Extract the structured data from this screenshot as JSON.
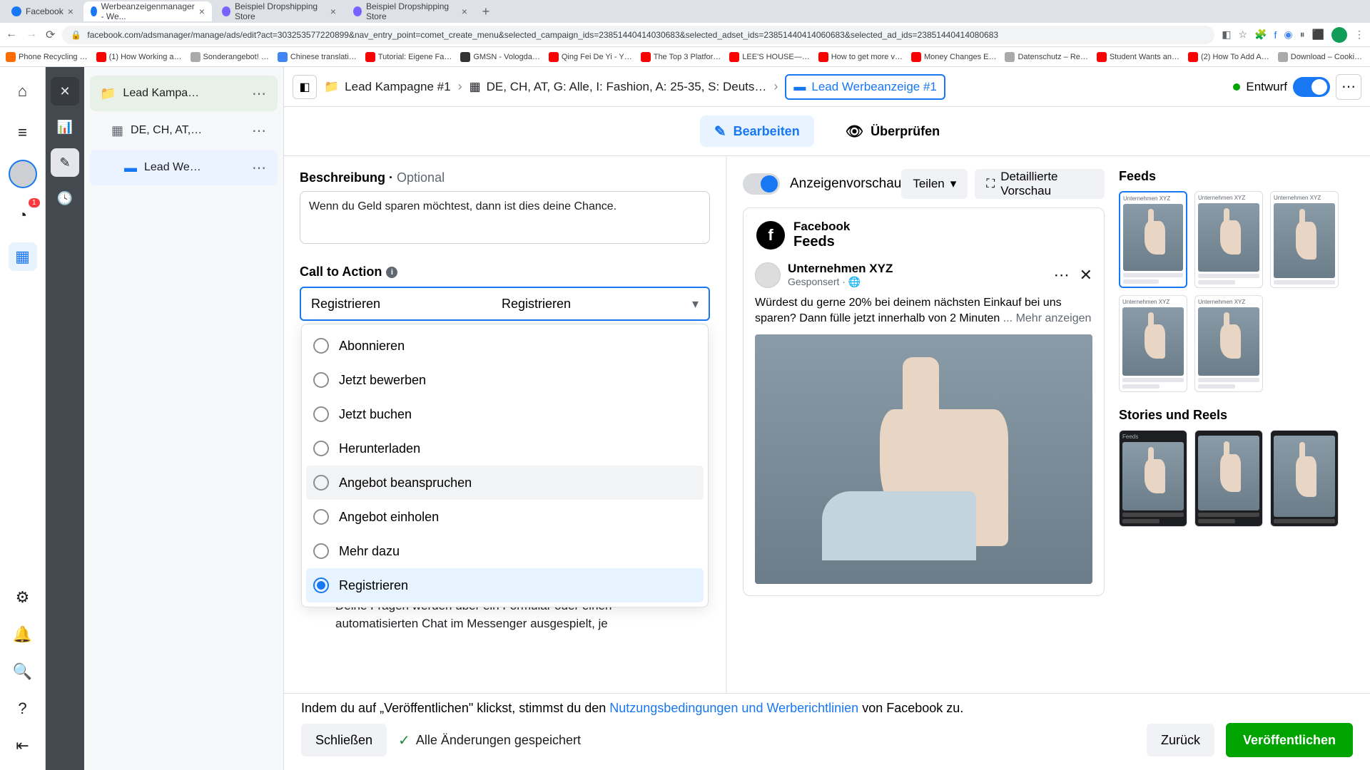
{
  "browser": {
    "tabs": [
      {
        "title": "Facebook"
      },
      {
        "title": "Werbeanzeigenmanager - We..."
      },
      {
        "title": "Beispiel Dropshipping Store"
      },
      {
        "title": "Beispiel Dropshipping Store"
      }
    ],
    "url": "facebook.com/adsmanager/manage/ads/edit?act=303253577220899&nav_entry_point=comet_create_menu&selected_campaign_ids=23851440414030683&selected_adset_ids=23851440414060683&selected_ad_ids=23851440414080683",
    "bookmarks": [
      "Phone Recycling …",
      "(1) How Working a…",
      "Sonderangebot! …",
      "Chinese translati…",
      "Tutorial: Eigene Fa…",
      "GMSN - Vologda…",
      "Qing Fei De Yi - Y…",
      "The Top 3 Platfor…",
      "LEE'S HOUSE—…",
      "How to get more v…",
      "Money Changes E…",
      "Datenschutz – Re…",
      "Student Wants an…",
      "(2) How To Add A…",
      "Download – Cooki…"
    ]
  },
  "tree": {
    "campaign": "Lead Kampa…",
    "adset": "DE, CH, AT,…",
    "ad": "Lead We…"
  },
  "crumbs": {
    "campaign": "Lead Kampagne #1",
    "adset": "DE, CH, AT, G: Alle, I: Fashion, A: 25-35, S: Deuts…",
    "ad": "Lead Werbeanzeige #1",
    "status": "Entwurf"
  },
  "tabs": {
    "edit": "Bearbeiten",
    "review": "Überprüfen"
  },
  "editor": {
    "desc_label": "Beschreibung",
    "optional": "Optional",
    "desc_value": "Wenn du Geld sparen möchtest, dann ist dies deine Chance.",
    "cta_label": "Call to Action",
    "cta_value": "Registrieren",
    "cta_options": [
      "Abonnieren",
      "Jetzt bewerben",
      "Jetzt buchen",
      "Herunterladen",
      "Angebot beanspruchen",
      "Angebot einholen",
      "Mehr dazu",
      "Registrieren"
    ],
    "cta_hover_index": 4,
    "cta_selected_index": 7,
    "below_text": "Deine Fragen werden über ein Formular oder einen automatisierten Chat im Messenger ausgespielt, je"
  },
  "preview": {
    "title": "Anzeigenvorschau",
    "share": "Teilen",
    "detail": "Detaillierte Vorschau",
    "card_name": "Facebook",
    "card_sub": "Feeds",
    "advertiser": "Unternehmen XYZ",
    "sponsored": "Gesponsert",
    "ad_text": "Würdest du gerne 20% bei deinem nächsten Einkauf bei uns sparen? Dann fülle jetzt innerhalb von 2 Minuten",
    "more": "... Mehr anzeigen",
    "side_feeds": "Feeds",
    "side_stories": "Stories und Reels"
  },
  "footer": {
    "terms_pre": "Indem du auf „Veröffentlichen\" klickst, stimmst du den ",
    "terms_link": "Nutzungsbedingungen und Werberichtlinien",
    "terms_post": " von Facebook zu.",
    "close": "Schließen",
    "saved": "Alle Änderungen gespeichert",
    "back": "Zurück",
    "publish": "Veröffentlichen"
  }
}
